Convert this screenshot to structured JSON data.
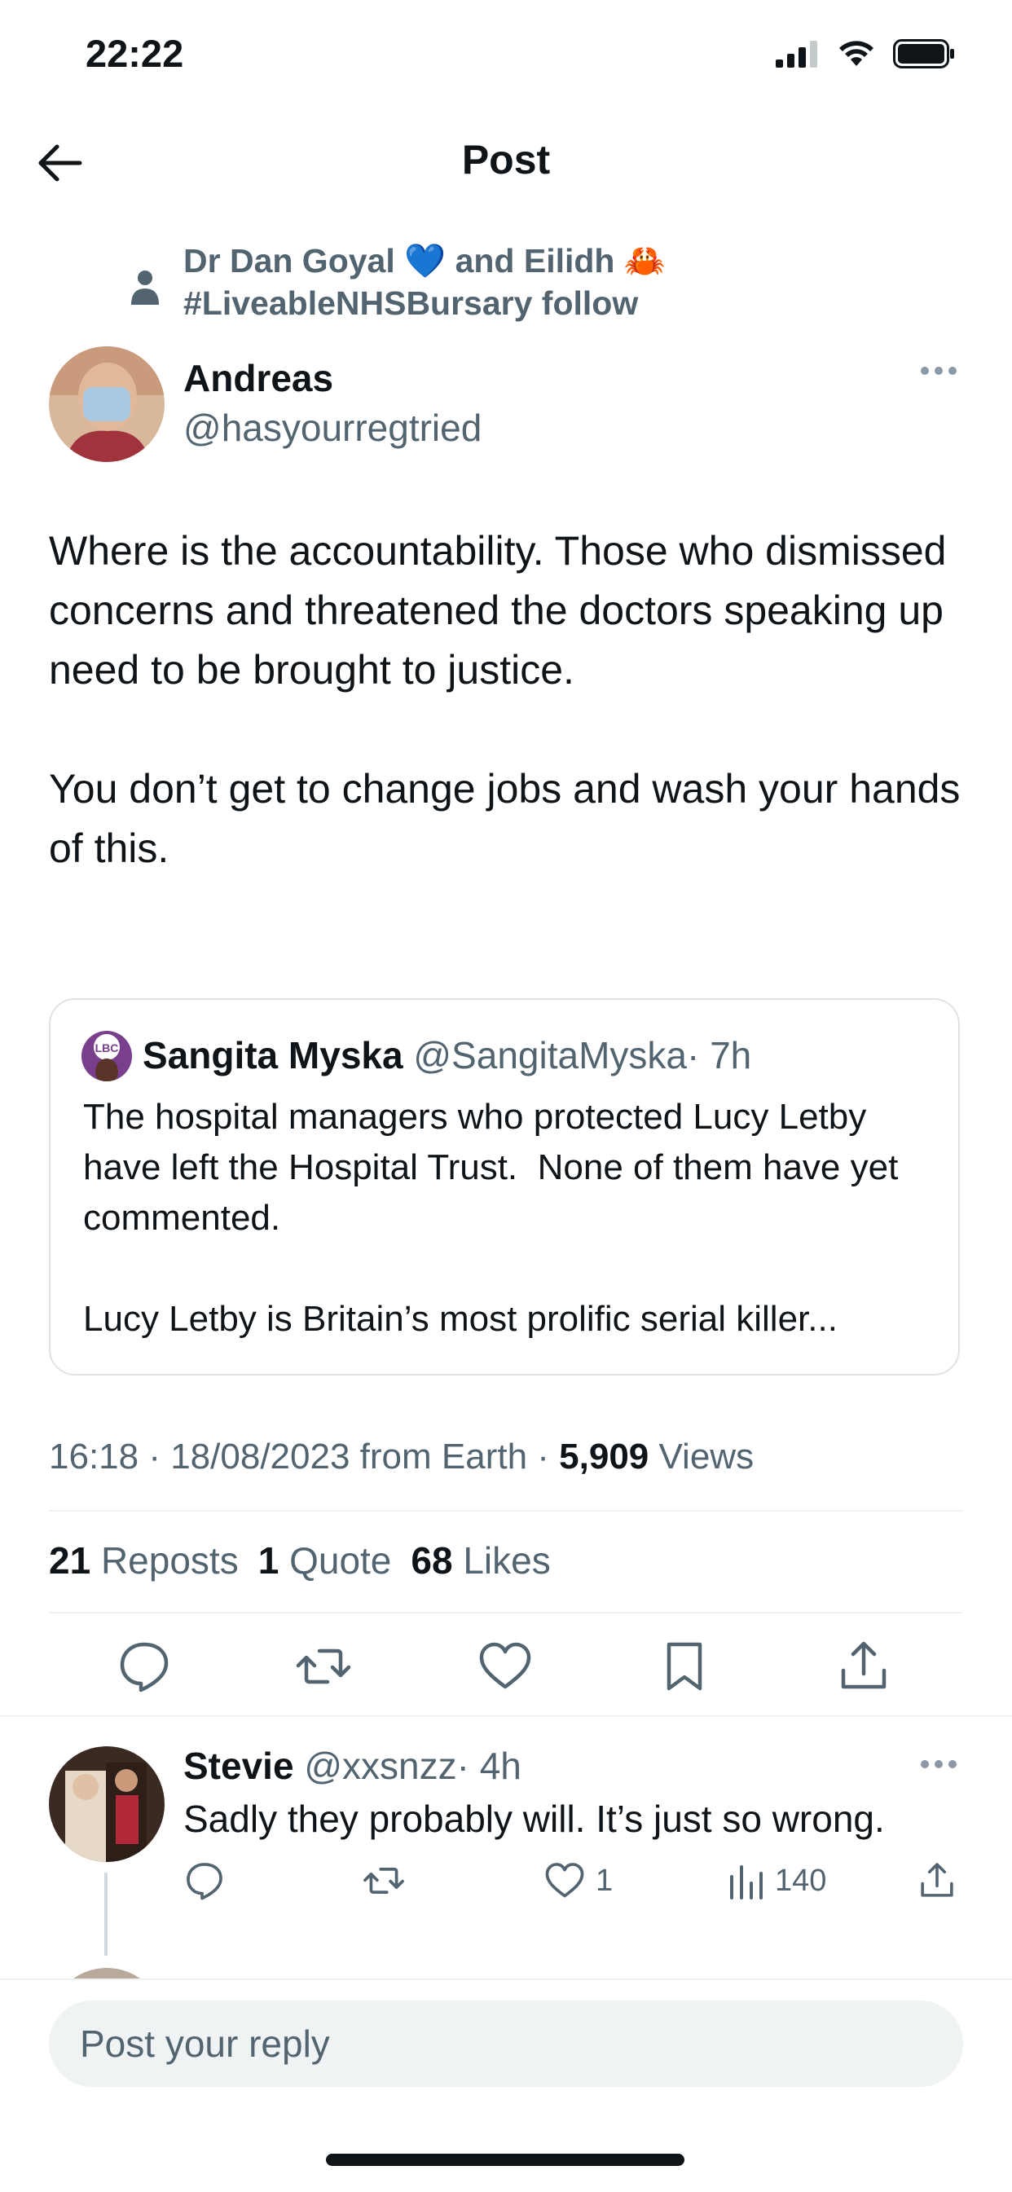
{
  "status_bar": {
    "time": "22:22"
  },
  "header": {
    "title": "Post"
  },
  "social_context": {
    "text": "Dr Dan Goyal 💙 and Eilidh 🦀 #LiveableNHSBursary follow"
  },
  "post": {
    "author_name": "Andreas",
    "author_handle": "@hasyourregtried",
    "text": "Where is the accountability. Those who dismissed concerns and threatened the doctors speaking up need to be brought to justice.\n\nYou don’t get to change jobs and wash your hands of this.",
    "quote": {
      "name": "Sangita Myska",
      "handle": "@SangitaMyska",
      "time": "· 7h",
      "text": "The hospital managers who protected Lucy Letby have left the Hospital Trust.  None of them have yet commented.\n\nLucy Letby is Britain’s most prolific serial killer..."
    },
    "meta": {
      "time_date": "16:18 · 18/08/2023 from Earth ·",
      "views_count": "5,909",
      "views_label": "Views"
    },
    "stats": {
      "reposts_count": "21",
      "reposts_label": "Reposts",
      "quotes_count": "1",
      "quotes_label": "Quote",
      "likes_count": "68",
      "likes_label": "Likes"
    }
  },
  "reply": {
    "name": "Stevie",
    "handle": "@xxsnzz",
    "time": "· 4h",
    "text": "Sadly they probably will. It’s just so wrong.",
    "likes": "1",
    "views": "140"
  },
  "composer": {
    "placeholder": "Post your reply"
  },
  "icons": {
    "back": "arrow-left-icon",
    "person": "person-icon",
    "reply": "reply-icon",
    "repost": "repost-icon",
    "like": "heart-icon",
    "bookmark": "bookmark-icon",
    "share": "share-icon",
    "views": "views-icon",
    "more": "more-icon"
  },
  "colors": {
    "text": "#0f1419",
    "muted": "#536471",
    "divider": "#eff3f4"
  }
}
